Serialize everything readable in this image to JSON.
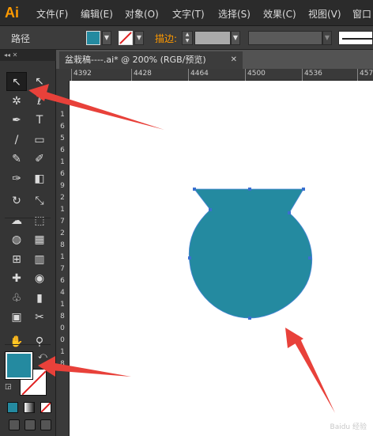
{
  "app": {
    "logo": "Ai"
  },
  "menu": [
    "文件(F)",
    "编辑(E)",
    "对象(O)",
    "文字(T)",
    "选择(S)",
    "效果(C)",
    "视图(V)",
    "窗口"
  ],
  "control_bar": {
    "object_type": "路径",
    "stroke_label": "描边:",
    "fill_color": "#248aa0",
    "stroke_color": "none"
  },
  "document": {
    "tab_title": "盆栽稿----.ai* @ 200% (RGB/预览)",
    "close_glyph": "✕",
    "ruler_labels": [
      "4392",
      "4428",
      "4464",
      "4500",
      "4536",
      "457"
    ],
    "vertical_ruler_digits": [
      "1",
      "6",
      "5",
      "6",
      "1",
      "6",
      "9",
      "2",
      "1",
      "7",
      "2",
      "8",
      "1",
      "7",
      "6",
      "4",
      "1",
      "8",
      "0",
      "0",
      "1",
      "8"
    ]
  },
  "tools": [
    "selection-tool",
    "direct-selection-tool",
    "magic-wand-tool",
    "lasso-tool",
    "pen-tool",
    "type-tool",
    "line-tool",
    "rectangle-tool",
    "paintbrush-tool",
    "pencil-tool",
    "blob-brush-tool",
    "eraser-tool",
    "rotate-tool",
    "scale-tool",
    "warp-tool",
    "free-transform-tool",
    "shape-builder-tool",
    "perspective-grid-tool",
    "mesh-tool",
    "gradient-tool",
    "eyedropper-tool",
    "blend-tool",
    "symbol-sprayer-tool",
    "column-graph-tool",
    "artboard-tool",
    "slice-tool",
    "hand-tool",
    "zoom-tool"
  ],
  "tool_glyphs": [
    "↖",
    "↖",
    "✲",
    "ℓ",
    "✒",
    "T",
    "/",
    "▭",
    "✎",
    "✐",
    "✑",
    "◧",
    "↻",
    "⤡",
    "☁",
    "⬚",
    "◍",
    "▦",
    "⊞",
    "▥",
    "✚",
    "◉",
    "♧",
    "▮",
    "▣",
    "✂",
    "✋",
    "⚲"
  ],
  "colors": {
    "fill": "#248aa0",
    "stroke": "none",
    "shape": "#248aa0",
    "arrow": "#e8413a"
  },
  "watermark": "Baidu 经验"
}
